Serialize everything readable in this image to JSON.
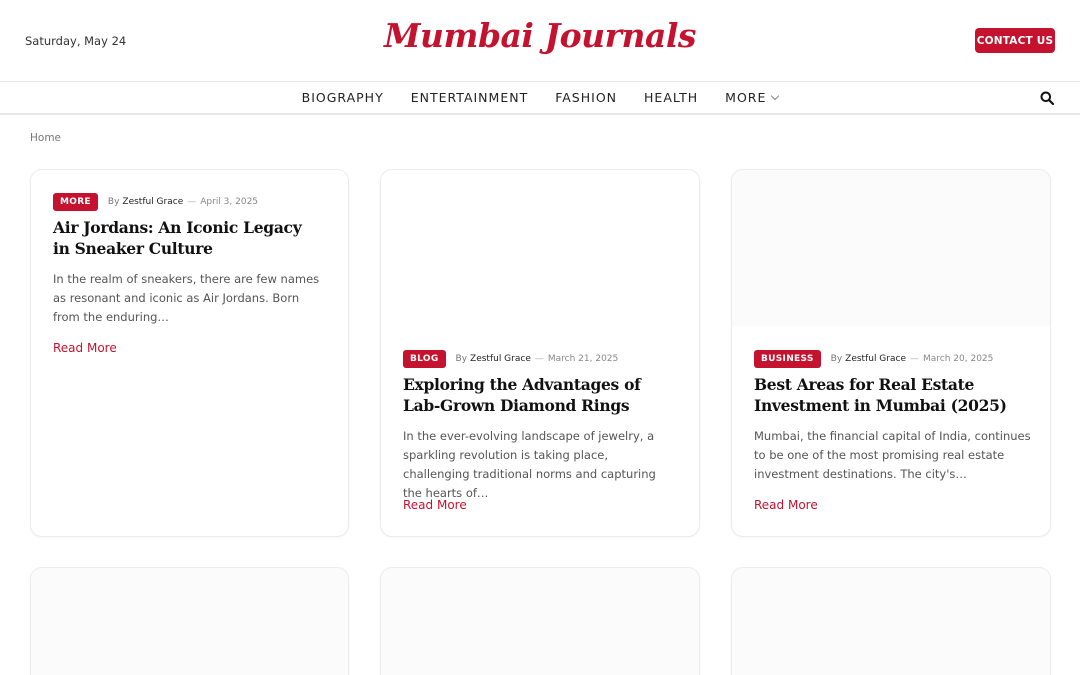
{
  "header": {
    "date": "Saturday, May 24",
    "logo": "Mumbai Journals",
    "contact_label": "CONTACT US"
  },
  "nav": {
    "items": [
      {
        "label": "BIOGRAPHY"
      },
      {
        "label": "ENTERTAINMENT"
      },
      {
        "label": "FASHION"
      },
      {
        "label": "HEALTH"
      },
      {
        "label": "MORE"
      }
    ]
  },
  "breadcrumb": "Home",
  "cards": [
    {
      "category": "MORE",
      "by": "By",
      "author": "Zestful Grace",
      "date": "April 3, 2025",
      "title": "Air Jordans: An Iconic Legacy in Sneaker Culture",
      "excerpt": "In the realm of sneakers, there are few names as resonant and iconic as Air Jordans. Born from the enduring…",
      "read_more": "Read More"
    },
    {
      "category": "BLOG",
      "by": "By",
      "author": "Zestful Grace",
      "date": "March 21, 2025",
      "title": " Exploring the Advantages of Lab-Grown Diamond Rings",
      "excerpt": "In the ever-evolving landscape of jewelry, a sparkling revolution is taking place, challenging traditional norms and capturing the hearts of…",
      "read_more": "Read More"
    },
    {
      "category": "BUSINESS",
      "by": "By",
      "author": "Zestful Grace",
      "date": "March 20, 2025",
      "title": "Best Areas for Real Estate Investment in Mumbai (2025)",
      "excerpt": "Mumbai, the financial capital of India, continues to be one of the most promising real estate investment destinations. The city's…",
      "read_more": "Read More"
    }
  ],
  "colors": {
    "accent": "#c4122f"
  }
}
